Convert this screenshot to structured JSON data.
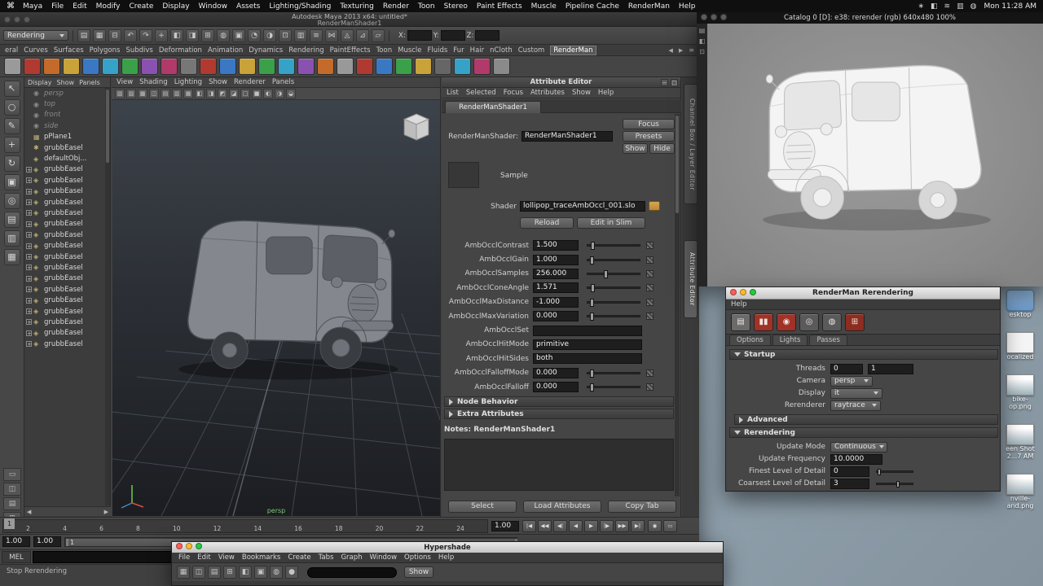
{
  "menubar": {
    "apple_icon": "⌘",
    "items": [
      "Maya",
      "File",
      "Edit",
      "Modify",
      "Create",
      "Display",
      "Window",
      "Assets",
      "Lighting/Shading",
      "Texturing",
      "Render",
      "Toon",
      "Stereo",
      "Paint Effects",
      "Muscle",
      "Pipeline Cache",
      "RenderMan",
      "Help"
    ],
    "status_icons": [
      {
        "glyph": "∗"
      },
      {
        "glyph": "◧"
      },
      {
        "glyph": "≋"
      },
      {
        "glyph": "▥"
      },
      {
        "glyph": "◍"
      }
    ],
    "clock": "Mon 11:28 AM"
  },
  "maya": {
    "title": "Autodesk Maya 2013 x64: untitled*",
    "subtitle": "RenderManShader1",
    "menuset": "Rendering",
    "toolbar_icons": [
      {
        "glyph": "▤"
      },
      {
        "glyph": "▦"
      },
      {
        "glyph": "⊟"
      },
      {
        "glyph": "↶"
      },
      {
        "glyph": "↷"
      },
      {
        "glyph": "+"
      },
      {
        "glyph": "◧"
      },
      {
        "glyph": "◨"
      },
      {
        "glyph": "⊞"
      },
      {
        "glyph": "◍"
      },
      {
        "glyph": "▣"
      },
      {
        "glyph": "◔"
      },
      {
        "glyph": "◑"
      },
      {
        "glyph": "⊡"
      },
      {
        "glyph": "▥"
      },
      {
        "glyph": "≡"
      },
      {
        "glyph": "⋈"
      },
      {
        "glyph": "◬"
      },
      {
        "glyph": "⊿"
      },
      {
        "glyph": "▱"
      }
    ],
    "xyz": [
      {
        "label": "X:"
      },
      {
        "label": "Y:"
      },
      {
        "label": "Z:"
      }
    ],
    "shelf_tabs": [
      "eral",
      "Curves",
      "Surfaces",
      "Polygons",
      "Subdivs",
      "Deformation",
      "Animation",
      "Dynamics",
      "Rendering",
      "PaintEffects",
      "Toon",
      "Muscle",
      "Fluids",
      "Fur",
      "Hair",
      "nCloth",
      "Custom",
      "RenderMan"
    ],
    "active_shelf_tab": "RenderMan",
    "shelf_icons": [
      {
        "color": "#9a9a9a"
      },
      {
        "color": "#b03a30"
      },
      {
        "color": "#c46a2a"
      },
      {
        "color": "#c9a23a"
      },
      {
        "color": "#3a78c4"
      },
      {
        "color": "#37a2c8"
      },
      {
        "color": "#3aa04a"
      },
      {
        "color": "#8a52b0"
      },
      {
        "color": "#b03a6a"
      },
      {
        "color": "#777777"
      },
      {
        "color": "#b03a30"
      },
      {
        "color": "#3a78c4"
      },
      {
        "color": "#c9a23a"
      },
      {
        "color": "#3aa04a"
      },
      {
        "color": "#37a2c8"
      },
      {
        "color": "#8a52b0"
      },
      {
        "color": "#c46a2a"
      },
      {
        "color": "#999999"
      },
      {
        "color": "#b03a30"
      },
      {
        "color": "#3a78c4"
      },
      {
        "color": "#3aa04a"
      },
      {
        "color": "#c9a23a"
      },
      {
        "color": "#666666"
      },
      {
        "color": "#37a2c8"
      },
      {
        "color": "#b03a6a"
      },
      {
        "color": "#8a8a8a"
      }
    ],
    "toolbox_icons": [
      {
        "glyph": "↖"
      },
      {
        "glyph": "○"
      },
      {
        "glyph": "✎"
      },
      {
        "glyph": "+"
      },
      {
        "glyph": "↻"
      },
      {
        "glyph": "▣"
      },
      {
        "glyph": "◎"
      },
      {
        "glyph": "▤"
      },
      {
        "glyph": "▥"
      },
      {
        "glyph": "▦"
      }
    ],
    "layout_buttons": [
      {
        "glyph": "▭"
      },
      {
        "glyph": "◫"
      },
      {
        "glyph": "▤"
      },
      {
        "glyph": "⊞"
      }
    ],
    "outliner": {
      "menu": [
        "Display",
        "Show",
        "Panels"
      ],
      "scroll_icons": [
        {
          "glyph": "◀"
        },
        {
          "glyph": "▶"
        }
      ],
      "items": [
        {
          "label": "persp",
          "icon": "◉",
          "cls": "dim"
        },
        {
          "label": "top",
          "icon": "◉",
          "cls": "dim"
        },
        {
          "label": "front",
          "icon": "◉",
          "cls": "dim"
        },
        {
          "label": "side",
          "icon": "◉",
          "cls": "dim"
        },
        {
          "label": "pPlane1",
          "icon": "▦"
        },
        {
          "label": "grubbEasel",
          "icon": "✱"
        },
        {
          "label": "defaultObj...",
          "icon": "◈"
        },
        {
          "label": "grubbEasel",
          "icon": "◈",
          "plus": "+"
        },
        {
          "label": "grubbEasel",
          "icon": "◈",
          "plus": "+"
        },
        {
          "label": "grubbEasel",
          "icon": "◈",
          "plus": "+"
        },
        {
          "label": "grubbEasel",
          "icon": "◈",
          "plus": "+"
        },
        {
          "label": "grubbEasel",
          "icon": "◈",
          "plus": "+"
        },
        {
          "label": "grubbEasel",
          "icon": "◈",
          "plus": "+"
        },
        {
          "label": "grubbEasel",
          "icon": "◈",
          "plus": "+"
        },
        {
          "label": "grubbEasel",
          "icon": "◈",
          "plus": "+"
        },
        {
          "label": "grubbEasel",
          "icon": "◈",
          "plus": "+"
        },
        {
          "label": "grubbEasel",
          "icon": "◈",
          "plus": "+"
        },
        {
          "label": "grubbEasel",
          "icon": "◈",
          "plus": "+"
        },
        {
          "label": "grubbEasel",
          "icon": "◈",
          "plus": "+"
        },
        {
          "label": "grubbEasel",
          "icon": "◈",
          "plus": "+"
        },
        {
          "label": "grubbEasel",
          "icon": "◈",
          "plus": "+"
        },
        {
          "label": "grubbEasel",
          "icon": "◈",
          "plus": "+"
        },
        {
          "label": "grubbEasel",
          "icon": "◈",
          "plus": "+"
        },
        {
          "label": "grubbEasel",
          "icon": "◈",
          "plus": "+"
        }
      ]
    },
    "viewport": {
      "menu": [
        "View",
        "Shading",
        "Lighting",
        "Show",
        "Renderer",
        "Panels"
      ],
      "bar_icons": [
        {
          "glyph": "▧"
        },
        {
          "glyph": "▨"
        },
        {
          "glyph": "▩"
        },
        {
          "glyph": "◫"
        },
        {
          "glyph": "▤"
        },
        {
          "glyph": "▥"
        },
        {
          "glyph": "▦"
        },
        {
          "glyph": "◧"
        },
        {
          "glyph": "◨"
        },
        {
          "glyph": "◩"
        },
        {
          "glyph": "◪"
        },
        {
          "glyph": "□"
        },
        {
          "glyph": "■"
        },
        {
          "glyph": "◐"
        },
        {
          "glyph": "◑"
        },
        {
          "glyph": "◒"
        }
      ],
      "camera_label": "persp"
    },
    "panel_tabs": [
      {
        "label": "Channel Box / Layer Editor"
      },
      {
        "label": "Attribute Editor"
      }
    ],
    "timeline": {
      "ticks": [
        "2",
        "4",
        "6",
        "8",
        "10",
        "12",
        "14",
        "16",
        "18",
        "20",
        "22",
        "24"
      ],
      "current": "1",
      "frame": "1.00",
      "transport": [
        {
          "glyph": "|◀"
        },
        {
          "glyph": "◀◀"
        },
        {
          "glyph": "◀|"
        },
        {
          "glyph": "◀"
        },
        {
          "glyph": "▶"
        },
        {
          "glyph": "|▶"
        },
        {
          "glyph": "▶▶"
        },
        {
          "glyph": "▶|"
        }
      ],
      "extras": [
        {
          "glyph": "◉"
        },
        {
          "glyph": "▭"
        }
      ],
      "range_a": "1.00",
      "range_b": "1.00",
      "range_label": "1"
    },
    "mel_label": "MEL",
    "status_line": "Stop Rerendering"
  },
  "attribute_editor": {
    "title": "Attribute Editor",
    "header_icons": [
      {
        "glyph": "−"
      },
      {
        "glyph": "□"
      }
    ],
    "menu": [
      "List",
      "Selected",
      "Focus",
      "Attributes",
      "Show",
      "Help"
    ],
    "tab": "RenderManShader1",
    "node_label": "RenderManShader:",
    "node_value": "RenderManShader1",
    "focus_btn": "Focus",
    "presets_btn": "Presets",
    "show_btn": "Show",
    "hide_btn": "Hide",
    "sample_label": "Sample",
    "shader_label": "Shader",
    "shader_value": "lollipop_traceAmbOccl_001.slo",
    "reload_btn": "Reload",
    "slim_btn": "Edit in Slim",
    "attrs": [
      {
        "label": "AmbOcclContrast",
        "value": "1.500",
        "type": "slider",
        "handle": "left:6%"
      },
      {
        "label": "AmbOcclGain",
        "value": "1.000",
        "type": "slider",
        "handle": "left:4%"
      },
      {
        "label": "AmbOcclSamples",
        "value": "256.000",
        "type": "slider",
        "handle": "left:32%"
      },
      {
        "label": "AmbOcclConeAngle",
        "value": "1.571",
        "type": "slider",
        "handle": "left:7%"
      },
      {
        "label": "AmbOcclMaxDistance",
        "value": "-1.000",
        "type": "slider",
        "handle": "left:4%"
      },
      {
        "label": "AmbOcclMaxVariation",
        "value": "0.000",
        "type": "slider",
        "handle": "left:4%"
      },
      {
        "label": "AmbOcclSet",
        "value": "",
        "type": "text"
      },
      {
        "label": "AmbOcclHitMode",
        "value": "primitive",
        "type": "text"
      },
      {
        "label": "AmbOcclHitSides",
        "value": "both",
        "type": "text"
      },
      {
        "label": "AmbOcclFalloffMode",
        "value": "0.000",
        "type": "slider",
        "handle": "left:4%"
      },
      {
        "label": "AmbOcclFalloff",
        "value": "0.000",
        "type": "slider",
        "handle": "left:4%"
      }
    ],
    "section_node_behavior": "Node Behavior",
    "section_extra": "Extra Attributes",
    "notes_label": "Notes:",
    "notes_value": "RenderManShader1",
    "select_btn": "Select",
    "load_btn": "Load Attributes",
    "copy_btn": "Copy Tab"
  },
  "render_view": {
    "title": "Catalog 0 [D]:  e38: rerender (rgb) 640x480 100%",
    "side_icons": [
      {
        "glyph": "▤"
      },
      {
        "glyph": "◧"
      },
      {
        "glyph": "⊡"
      }
    ]
  },
  "rerender": {
    "title": "RenderMan Rerendering",
    "menu": "Help",
    "toolbar": [
      {
        "glyph": "▤",
        "color": "#6b6b6b"
      },
      {
        "glyph": "▮▮",
        "color": "#a03227"
      },
      {
        "glyph": "◉",
        "color": "#a03227"
      },
      {
        "glyph": "◎",
        "color": "#5a5a5a"
      },
      {
        "glyph": "◍",
        "color": "#5a5a5a"
      },
      {
        "glyph": "⊞",
        "color": "#8c2d20"
      }
    ],
    "tabs": [
      "Options",
      "Lights",
      "Passes"
    ],
    "active_tab": "Options",
    "startup_header": "Startup",
    "threads_label": "Threads",
    "threads_v1": "0",
    "threads_v2": "1",
    "camera_label": "Camera",
    "camera_value": "persp",
    "display_label": "Display",
    "display_value": "it",
    "rerenderer_label": "Rerenderer",
    "rerenderer_value": "raytrace",
    "advanced_header": "Advanced",
    "rerendering_header": "Rerendering",
    "update_mode_label": "Update Mode",
    "update_mode_value": "Continuous",
    "update_freq_label": "Update Frequency",
    "update_freq_value": "10.0000",
    "finest_label": "Finest Level of Detail",
    "finest_value": "0",
    "coarsest_label": "Coarsest Level of Detail",
    "coarsest_value": "3"
  },
  "hypershade": {
    "title": "Hypershade",
    "menu": [
      "File",
      "Edit",
      "View",
      "Bookmarks",
      "Create",
      "Tabs",
      "Graph",
      "Window",
      "Options",
      "Help"
    ],
    "toolbar_icons": [
      {
        "glyph": "▦"
      },
      {
        "glyph": "◫"
      },
      {
        "glyph": "▤"
      },
      {
        "glyph": "⊞"
      },
      {
        "glyph": "◧"
      },
      {
        "glyph": "▣"
      },
      {
        "glyph": "◍"
      },
      {
        "glyph": "●"
      }
    ],
    "show_btn": "Show"
  },
  "desktop": {
    "icons": [
      {
        "line1": "esktop",
        "line2": "",
        "type": "folder"
      },
      {
        "line1": "ocalized",
        "line2": "",
        "type": "file"
      },
      {
        "line1": "bike-",
        "line2": "op.png",
        "type": "image"
      },
      {
        "line1": "een Shot",
        "line2": "2...7 AM",
        "type": "image"
      },
      {
        "line1": "nville-",
        "line2": "and.png",
        "type": "image"
      }
    ]
  }
}
